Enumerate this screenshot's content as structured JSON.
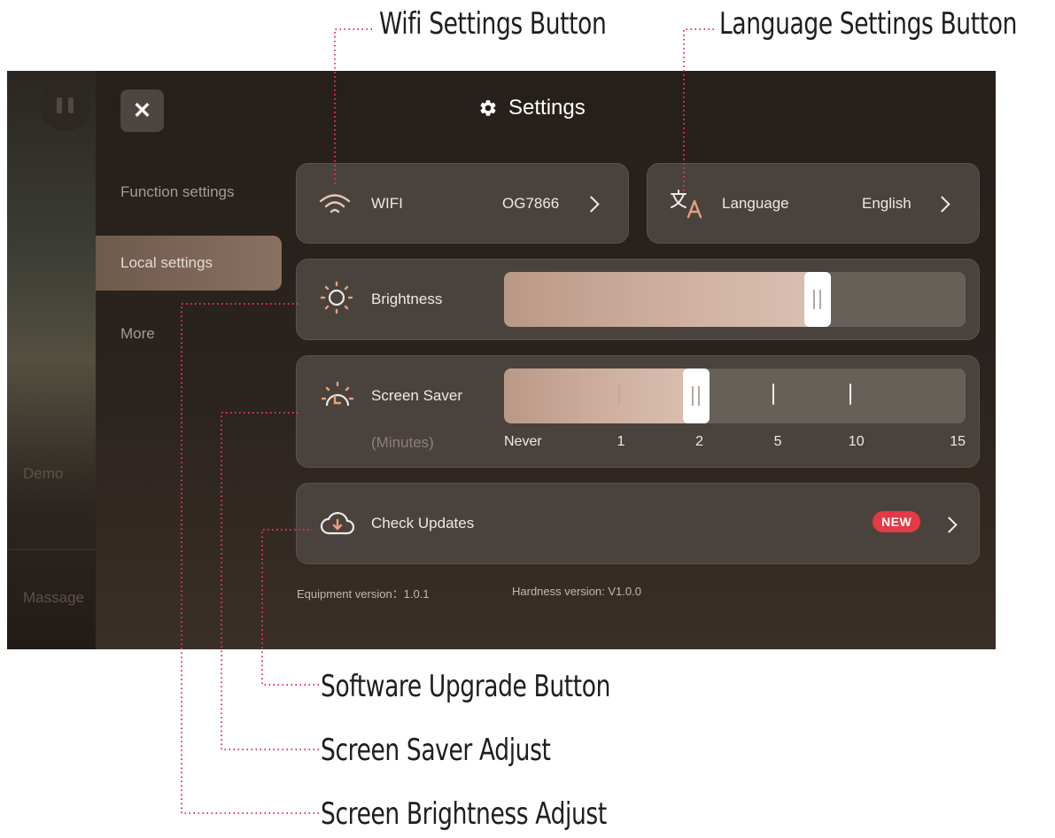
{
  "annotations": {
    "wifi": "Wifi Settings Button",
    "language": "Language Settings Button",
    "upgrade": "Software Upgrade Button",
    "screen_saver": "Screen Saver Adjust",
    "brightness": "Screen Brightness Adjust"
  },
  "background": {
    "demo": "Demo",
    "massage": "Massage"
  },
  "header": {
    "title": "Settings",
    "close_icon": "close-icon",
    "title_icon": "gear-icon"
  },
  "nav": [
    {
      "label": "Function settings",
      "active": false
    },
    {
      "label": "Local settings",
      "active": true
    },
    {
      "label": "More",
      "active": false
    }
  ],
  "wifi": {
    "label": "WIFI",
    "value": "OG7866",
    "icon": "wifi-icon"
  },
  "language": {
    "label": "Language",
    "value": "English",
    "icon": "translate-icon"
  },
  "brightness": {
    "label": "Brightness",
    "level": 0.68,
    "icon": "sun-icon"
  },
  "screen_saver": {
    "label": "Screen Saver",
    "unit": "(Minutes)",
    "options": [
      "Never",
      "1",
      "2",
      "5",
      "10",
      "15"
    ],
    "selected": "2",
    "icon": "sunrise-timer-icon"
  },
  "updates": {
    "label": "Check Updates",
    "badge": "NEW",
    "icon": "cloud-download-icon"
  },
  "versions": {
    "equipment": "Equipment version：1.0.1",
    "hardness": "Hardness version: V1.0.0"
  },
  "colors": {
    "accent": "#c8a898",
    "badge": "#e33a45",
    "annotation_line": "#e8336d"
  }
}
